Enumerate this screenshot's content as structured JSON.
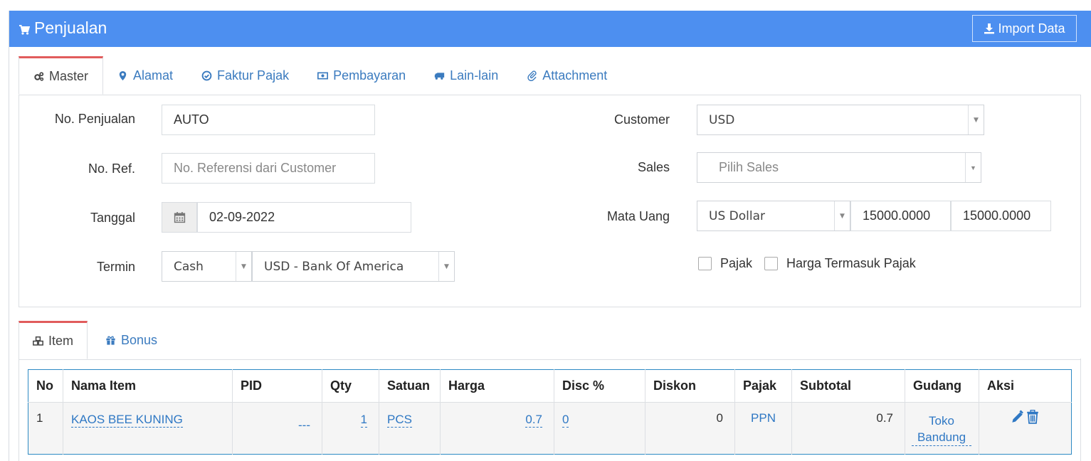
{
  "header": {
    "title": "Penjualan",
    "import_label": "Import Data"
  },
  "tabs": [
    {
      "label": "Master",
      "icon": "cogs-icon"
    },
    {
      "label": "Alamat",
      "icon": "map-marker-icon"
    },
    {
      "label": "Faktur Pajak",
      "icon": "check-circle-icon"
    },
    {
      "label": "Pembayaran",
      "icon": "money-icon"
    },
    {
      "label": "Lain-lain",
      "icon": "truck-icon"
    },
    {
      "label": "Attachment",
      "icon": "paperclip-icon"
    }
  ],
  "form": {
    "no_penjualan": {
      "label": "No. Penjualan",
      "value": "AUTO"
    },
    "no_ref": {
      "label": "No. Ref.",
      "placeholder": "No. Referensi dari Customer"
    },
    "tanggal": {
      "label": "Tanggal",
      "value": "02-09-2022"
    },
    "termin": {
      "label": "Termin",
      "value": "Cash",
      "bank": "USD - Bank Of America"
    },
    "customer": {
      "label": "Customer",
      "value": "USD"
    },
    "sales": {
      "label": "Sales",
      "placeholder": "Pilih Sales"
    },
    "mata_uang": {
      "label": "Mata Uang",
      "value": "US Dollar",
      "rate1": "15000.0000",
      "rate2": "15000.0000"
    },
    "pajak_label": "Pajak",
    "harga_termasuk_pajak_label": "Harga Termasuk Pajak"
  },
  "item_tabs": [
    {
      "label": "Item",
      "icon": "cubes-icon"
    },
    {
      "label": "Bonus",
      "icon": "gift-icon"
    }
  ],
  "table": {
    "headers": [
      "No",
      "Nama Item",
      "PID",
      "Qty",
      "Satuan",
      "Harga",
      "Disc %",
      "Diskon",
      "Pajak",
      "Subtotal",
      "Gudang",
      "Aksi"
    ],
    "rows": [
      {
        "no": "1",
        "nama_item": "KAOS BEE KUNING",
        "pid": "---",
        "qty": "1",
        "satuan": "PCS",
        "harga": "0.7",
        "disc": "0",
        "diskon": "0",
        "pajak": "PPN",
        "subtotal": "0.7",
        "gudang_line1": "Toko",
        "gudang_line2": "Bandung"
      }
    ]
  }
}
